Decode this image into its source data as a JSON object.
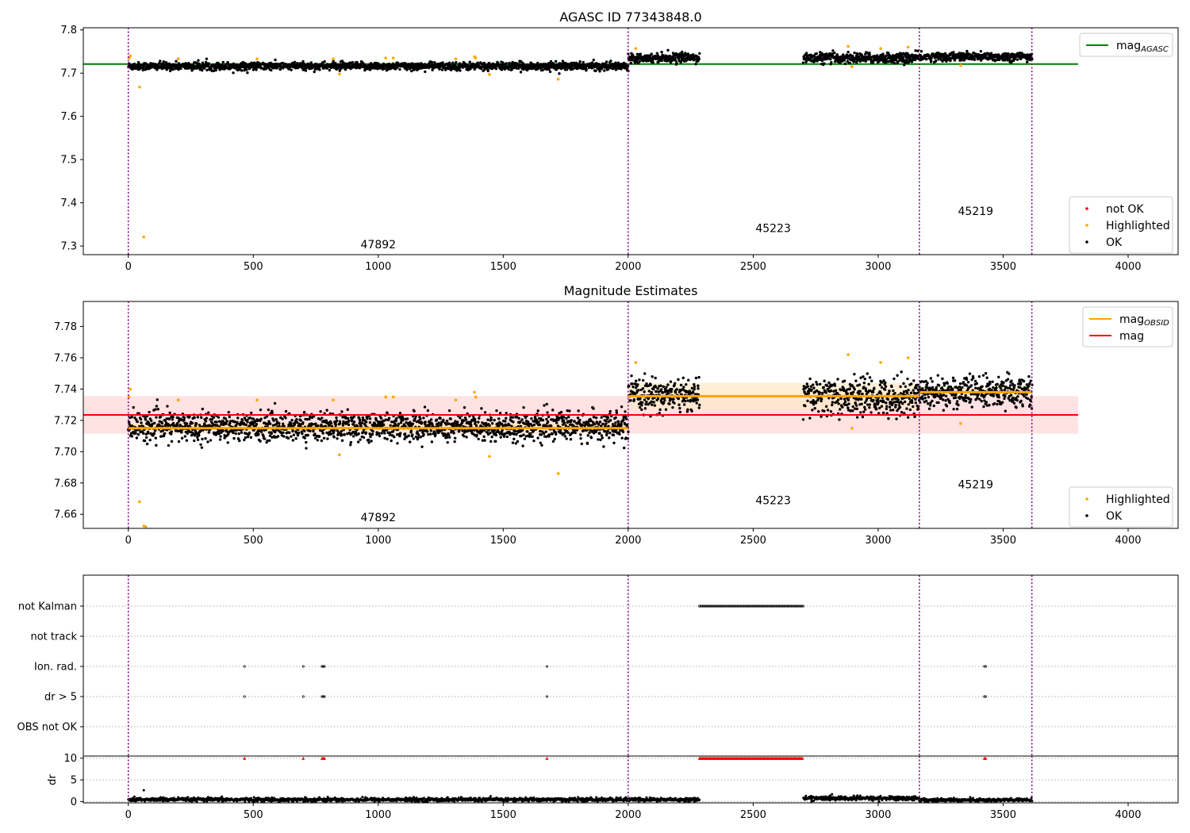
{
  "figure": {
    "background": "#ffffff",
    "colors": {
      "ok": "#000000",
      "highlighted": "#ffa500",
      "not_ok": "#ff0000",
      "mag_agasc": "#008000",
      "mag": "#ff0000",
      "mag_obsid": "#ffa500",
      "obs_boundary": "#800080",
      "band_mag": "#ffdddd",
      "band_obsid": "#ffe8c8",
      "grid": "#b0b0b0"
    }
  },
  "chart_data": [
    {
      "type": "scatter",
      "name": "panel-agasc",
      "title": "AGASC ID 77343848.0",
      "xlim": [
        -180,
        4200
      ],
      "ylim": [
        7.28,
        7.805
      ],
      "xticks": [
        0,
        500,
        1000,
        1500,
        2000,
        2500,
        3000,
        3500,
        4000
      ],
      "yticks": [
        7.3,
        7.4,
        7.5,
        7.6,
        7.7,
        7.8
      ],
      "ytick_labels": [
        "7.3",
        "7.4",
        "7.5",
        "7.6",
        "7.7",
        "7.8"
      ],
      "obs_boundaries": [
        0,
        2000,
        3165,
        3615
      ],
      "obs_labels": [
        {
          "text": "47892",
          "x": 1000,
          "y": 7.295
        },
        {
          "text": "45223",
          "x": 2580,
          "y": 7.332
        },
        {
          "text": "45219",
          "x": 3390,
          "y": 7.372
        }
      ],
      "ok_segments": [
        {
          "x_start": 0,
          "x_end": 2000,
          "mean": 7.716,
          "spread": 0.0045
        },
        {
          "x_start": 2000,
          "x_end": 2285,
          "mean": 7.736,
          "spread": 0.005
        },
        {
          "x_start": 2700,
          "x_end": 3165,
          "mean": 7.735,
          "spread": 0.006
        },
        {
          "x_start": 3165,
          "x_end": 3615,
          "mean": 7.738,
          "spread": 0.005
        }
      ],
      "highlighted_points": {
        "x": [
          3,
          8,
          45,
          62,
          200,
          515,
          820,
          845,
          1030,
          1060,
          1310,
          1385,
          1390,
          1445,
          1720,
          2030,
          2880,
          2895,
          3010,
          3120,
          3330
        ],
        "y": [
          7.735,
          7.74,
          7.668,
          7.321,
          7.733,
          7.733,
          7.733,
          7.698,
          7.735,
          7.735,
          7.733,
          7.738,
          7.735,
          7.697,
          7.686,
          7.757,
          7.762,
          7.715,
          7.757,
          7.76,
          7.718
        ]
      },
      "lines": [
        {
          "name": "mag",
          "name_sub": "AGASC",
          "y": 7.721,
          "x_start": -180,
          "x_end": 3800
        }
      ],
      "legends": [
        {
          "position": "upper-right",
          "entries": [
            {
              "label": "mag",
              "sub": "AGASC",
              "kind": "line",
              "color": "#008000"
            }
          ]
        },
        {
          "position": "lower-right",
          "entries": [
            {
              "label": "not OK",
              "kind": "point",
              "color": "#ff0000"
            },
            {
              "label": "Highlighted",
              "kind": "point",
              "color": "#ffa500"
            },
            {
              "label": "OK",
              "kind": "point",
              "color": "#000000"
            }
          ]
        }
      ]
    },
    {
      "type": "scatter",
      "name": "panel-estimates",
      "title": "Magnitude Estimates",
      "xlim": [
        -180,
        4200
      ],
      "ylim": [
        7.651,
        7.796
      ],
      "xticks": [
        0,
        500,
        1000,
        1500,
        2000,
        2500,
        3000,
        3500,
        4000
      ],
      "yticks": [
        7.66,
        7.68,
        7.7,
        7.72,
        7.74,
        7.76,
        7.78
      ],
      "ytick_labels": [
        "7.66",
        "7.68",
        "7.70",
        "7.72",
        "7.74",
        "7.76",
        "7.78"
      ],
      "obs_boundaries": [
        0,
        2000,
        3165,
        3615
      ],
      "obs_labels": [
        {
          "text": "47892",
          "x": 1000,
          "y": 7.6555
        },
        {
          "text": "45223",
          "x": 2580,
          "y": 7.6665
        },
        {
          "text": "45219",
          "x": 3390,
          "y": 7.6765
        }
      ],
      "mag_band": {
        "y": 7.7235,
        "y_low": 7.7115,
        "y_high": 7.7355,
        "x_start": -180,
        "x_end": 3800
      },
      "obsid_segments": [
        {
          "x_start": 0,
          "x_end": 2000,
          "y": 7.715,
          "y_low": 7.712,
          "y_high": 7.718
        },
        {
          "x_start": 2000,
          "x_end": 3165,
          "y": 7.7355,
          "y_low": 7.727,
          "y_high": 7.744
        },
        {
          "x_start": 3165,
          "x_end": 3615,
          "y": 7.738,
          "y_low": 7.735,
          "y_high": 7.741
        }
      ],
      "ok_segments": [
        {
          "x_start": 0,
          "x_end": 2000,
          "mean": 7.716,
          "spread": 0.0045
        },
        {
          "x_start": 2000,
          "x_end": 2285,
          "mean": 7.736,
          "spread": 0.005
        },
        {
          "x_start": 2700,
          "x_end": 3165,
          "mean": 7.735,
          "spread": 0.006
        },
        {
          "x_start": 3165,
          "x_end": 3615,
          "mean": 7.738,
          "spread": 0.005
        }
      ],
      "highlighted_points": {
        "x": [
          3,
          8,
          45,
          62,
          70,
          200,
          515,
          820,
          845,
          1030,
          1060,
          1310,
          1385,
          1390,
          1445,
          1720,
          2030,
          2880,
          2895,
          3010,
          3120,
          3330
        ],
        "y": [
          7.735,
          7.74,
          7.668,
          7.6525,
          7.652,
          7.733,
          7.733,
          7.733,
          7.698,
          7.735,
          7.735,
          7.733,
          7.738,
          7.735,
          7.697,
          7.686,
          7.757,
          7.762,
          7.715,
          7.757,
          7.76,
          7.718
        ]
      },
      "legends": [
        {
          "position": "upper-right",
          "entries": [
            {
              "label": "mag",
              "sub": "OBSID",
              "kind": "line",
              "color": "#ffa500"
            },
            {
              "label": "mag",
              "kind": "line",
              "color": "#ff0000"
            }
          ]
        },
        {
          "position": "lower-right",
          "entries": [
            {
              "label": "Highlighted",
              "kind": "point",
              "color": "#ffa500"
            },
            {
              "label": "OK",
              "kind": "point",
              "color": "#000000"
            }
          ]
        }
      ]
    },
    {
      "type": "scatter",
      "name": "panel-flags",
      "xlim": [
        -180,
        4200
      ],
      "categories": [
        "not Kalman",
        "not track",
        "Ion. rad.",
        "dr > 5",
        "OBS not OK"
      ],
      "obs_boundaries": [
        0,
        2000,
        3165,
        3615
      ],
      "flag_points": {
        "not Kalman": {
          "ranges": [
            [
              2285,
              2700
            ]
          ]
        },
        "not track": {
          "x": []
        },
        "Ion. rad.": {
          "x": [
            465,
            700,
            775,
            780,
            785,
            1675,
            3425,
            3430
          ]
        },
        "dr > 5": {
          "x": [
            465,
            700,
            775,
            780,
            785,
            1675,
            3425,
            3430
          ]
        },
        "OBS not OK": {
          "x": []
        }
      }
    },
    {
      "type": "scatter",
      "name": "panel-dr",
      "ylabel": "dr",
      "xlim": [
        -180,
        4200
      ],
      "ylim": [
        -0.3,
        10.5
      ],
      "xticks": [
        0,
        500,
        1000,
        1500,
        2000,
        2500,
        3000,
        3500,
        4000
      ],
      "yticks": [
        0,
        5,
        10
      ],
      "ytick_labels": [
        "0",
        "5",
        "10"
      ],
      "obs_boundaries": [
        0,
        2000,
        3165,
        3615
      ],
      "dr_segments": [
        {
          "x_start": 0,
          "x_end": 2285,
          "mean": 0.45,
          "spread": 0.22
        },
        {
          "x_start": 2700,
          "x_end": 3165,
          "mean": 0.75,
          "spread": 0.25
        },
        {
          "x_start": 3165,
          "x_end": 3615,
          "mean": 0.35,
          "spread": 0.2
        }
      ],
      "dr_outliers": {
        "x": [
          62
        ],
        "y": [
          2.6
        ]
      },
      "capped_points": {
        "y": 10,
        "x": [
          465,
          700,
          775,
          780,
          785,
          1675,
          3425,
          3430
        ],
        "ranges": [
          [
            2285,
            2700
          ]
        ]
      }
    }
  ]
}
